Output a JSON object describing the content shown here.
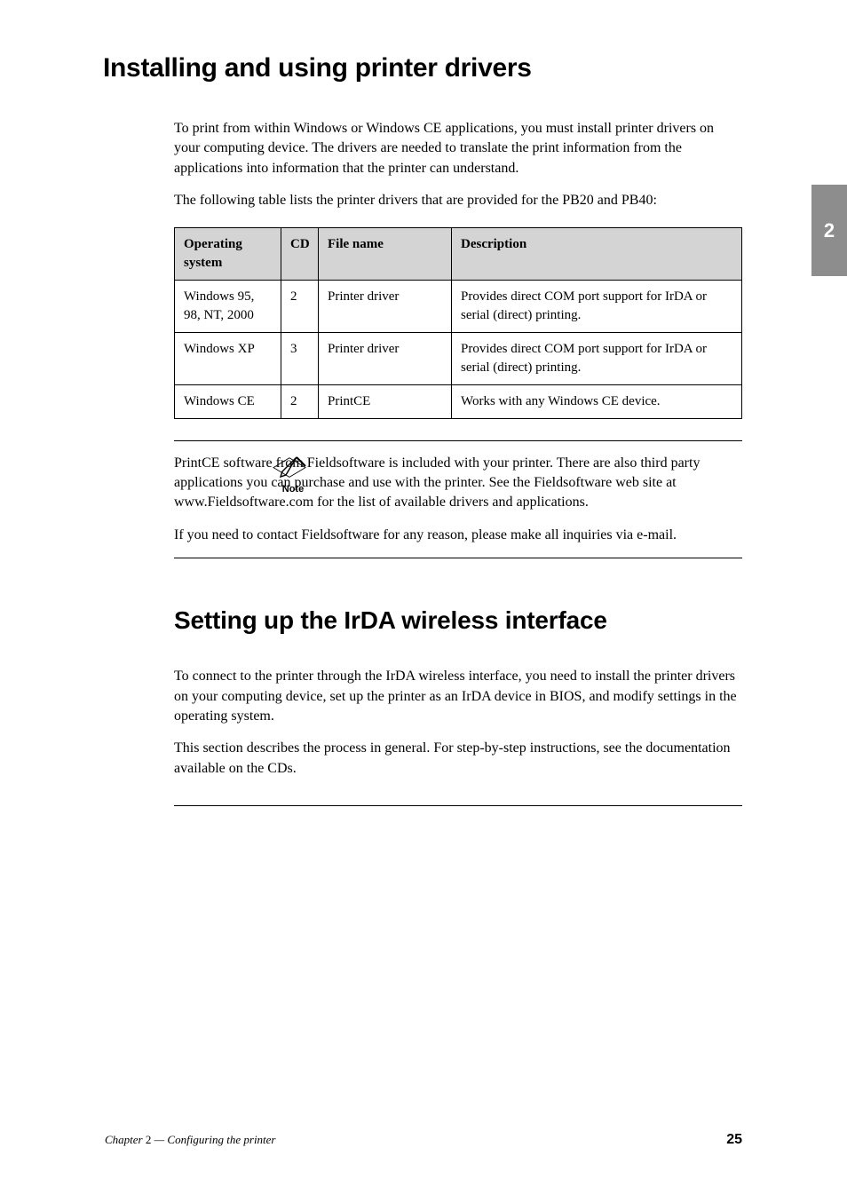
{
  "sideTab": "2",
  "section1": {
    "title": "Installing and using printer drivers",
    "paragraphs": [
      "To print from within Windows or Windows CE applications, you must install printer drivers on your computing device. The drivers are needed to translate the print information from the applications into information that the printer can understand.",
      "The following table lists the printer drivers that are provided for the PB20 and PB40:"
    ]
  },
  "table": {
    "headers": [
      "Operating system",
      "CD",
      "File name",
      "Description"
    ],
    "rows": [
      {
        "os": "Windows 95, 98, NT, 2000",
        "cd": "2",
        "file": "Printer driver",
        "desc": "Provides direct COM port support for IrDA or serial (direct) printing."
      },
      {
        "os": "Windows XP",
        "cd": "3",
        "file": "Printer driver",
        "desc": "Provides direct COM port support for IrDA or serial (direct) printing."
      },
      {
        "os": "Windows CE",
        "cd": "2",
        "file": "PrintCE",
        "desc": "Works with any Windows CE device."
      }
    ]
  },
  "note": {
    "iconLabel": "Note",
    "paragraphs": [
      "PrintCE software from Fieldsoftware is included with your printer. There are also third party applications you can purchase and use with the printer. See the Fieldsoftware web site at www.Fieldsoftware.com for the list of available drivers and applications.",
      "If you need to contact Fieldsoftware for any reason, please make all inquiries via e-mail."
    ]
  },
  "section2": {
    "title": "Setting up the IrDA wireless interface",
    "paragraphs": [
      "To connect to the printer through the IrDA wireless interface, you need to install the printer drivers on your computing device, set up the printer as an IrDA device in BIOS, and modify settings in the operating system.",
      "This section describes the process in general. For step-by-step instructions, see the documentation available on the CDs."
    ]
  },
  "footer": {
    "left_prefix": "Chapter ",
    "left_num": "2",
    "left_suffix": " — Configuring the printer",
    "right": "25"
  }
}
